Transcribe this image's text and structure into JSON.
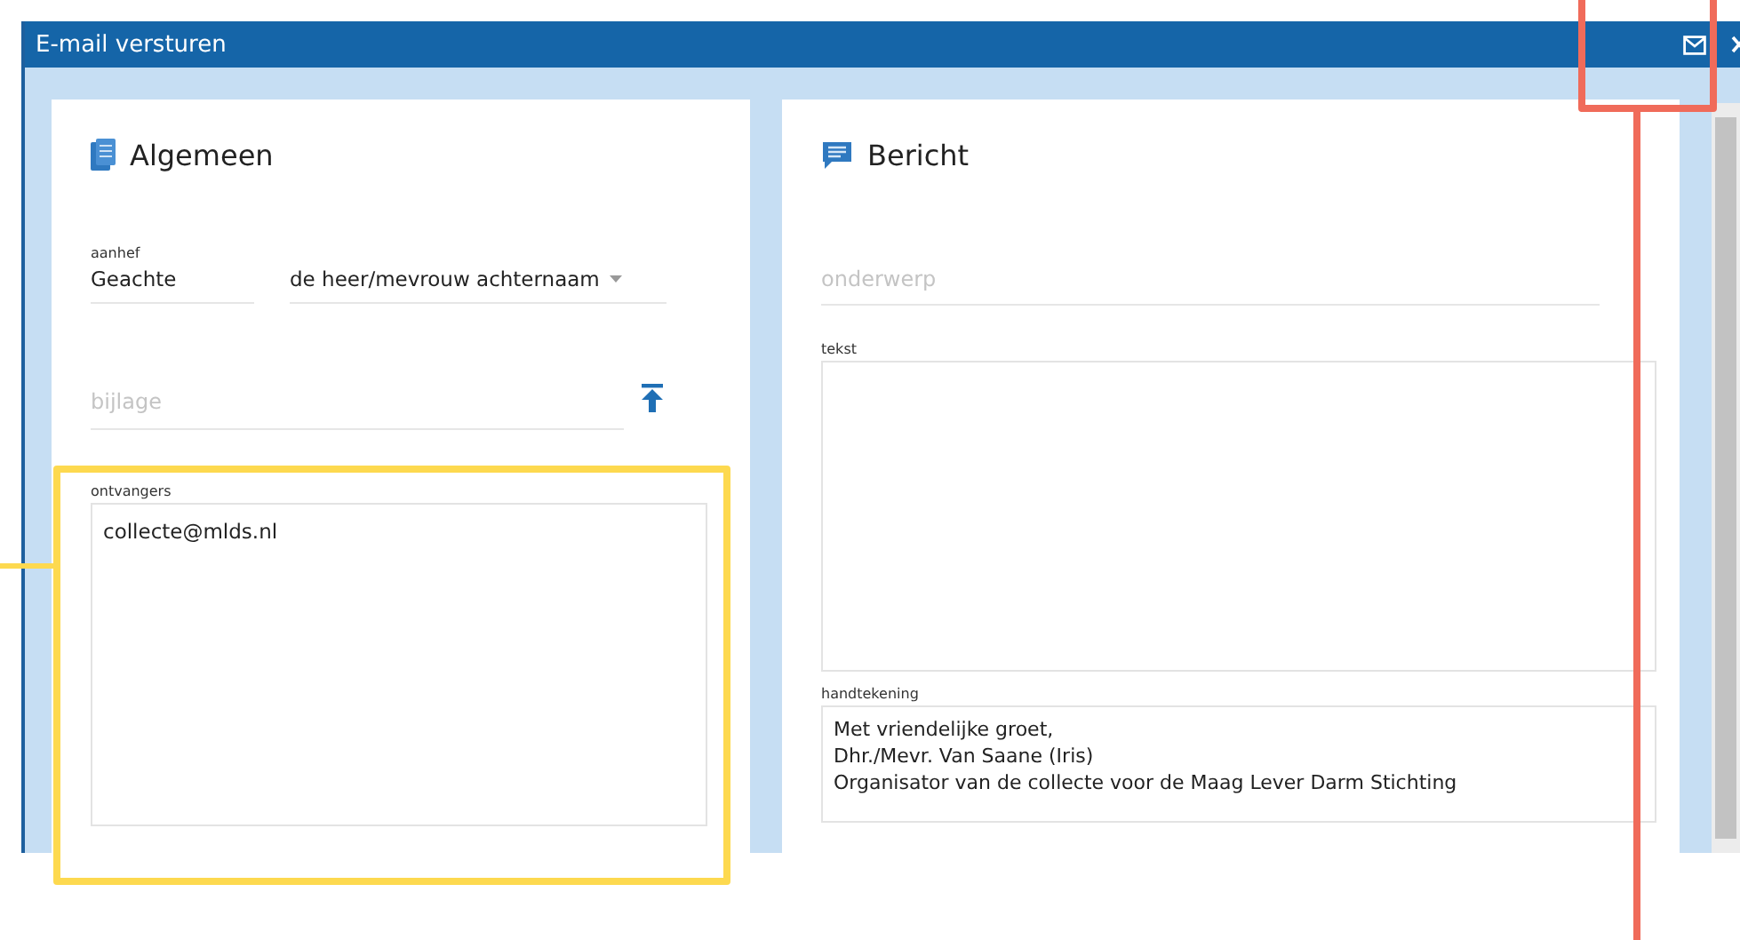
{
  "window": {
    "title": "E-mail versturen",
    "actions": [
      {
        "kind": "mail"
      },
      {
        "kind": "close"
      }
    ]
  },
  "general": {
    "title": "Algemeen",
    "salutation": {
      "label": "aanhef",
      "value": "Geachte"
    },
    "salutation_form": {
      "value": "de heer/mevrouw achternaam"
    },
    "attachment": {
      "placeholder": "bijlage"
    },
    "recipients": {
      "label": "ontvangers",
      "value": "collecte@mlds.nl"
    }
  },
  "message": {
    "title": "Bericht",
    "subject": {
      "placeholder": "onderwerp"
    },
    "text": {
      "label": "tekst"
    },
    "signature": {
      "label": "handtekening",
      "value": "Met vriendelijke groet,\nDhr./Mevr. Van Saane (Iris)\nOrganisator van de collecte voor de Maag Lever Darm Stichting"
    }
  },
  "annotations": {
    "recipients_frame": {
      "color": "#fdd94f"
    },
    "actions_frame": {
      "color": "#f06b5a"
    }
  }
}
